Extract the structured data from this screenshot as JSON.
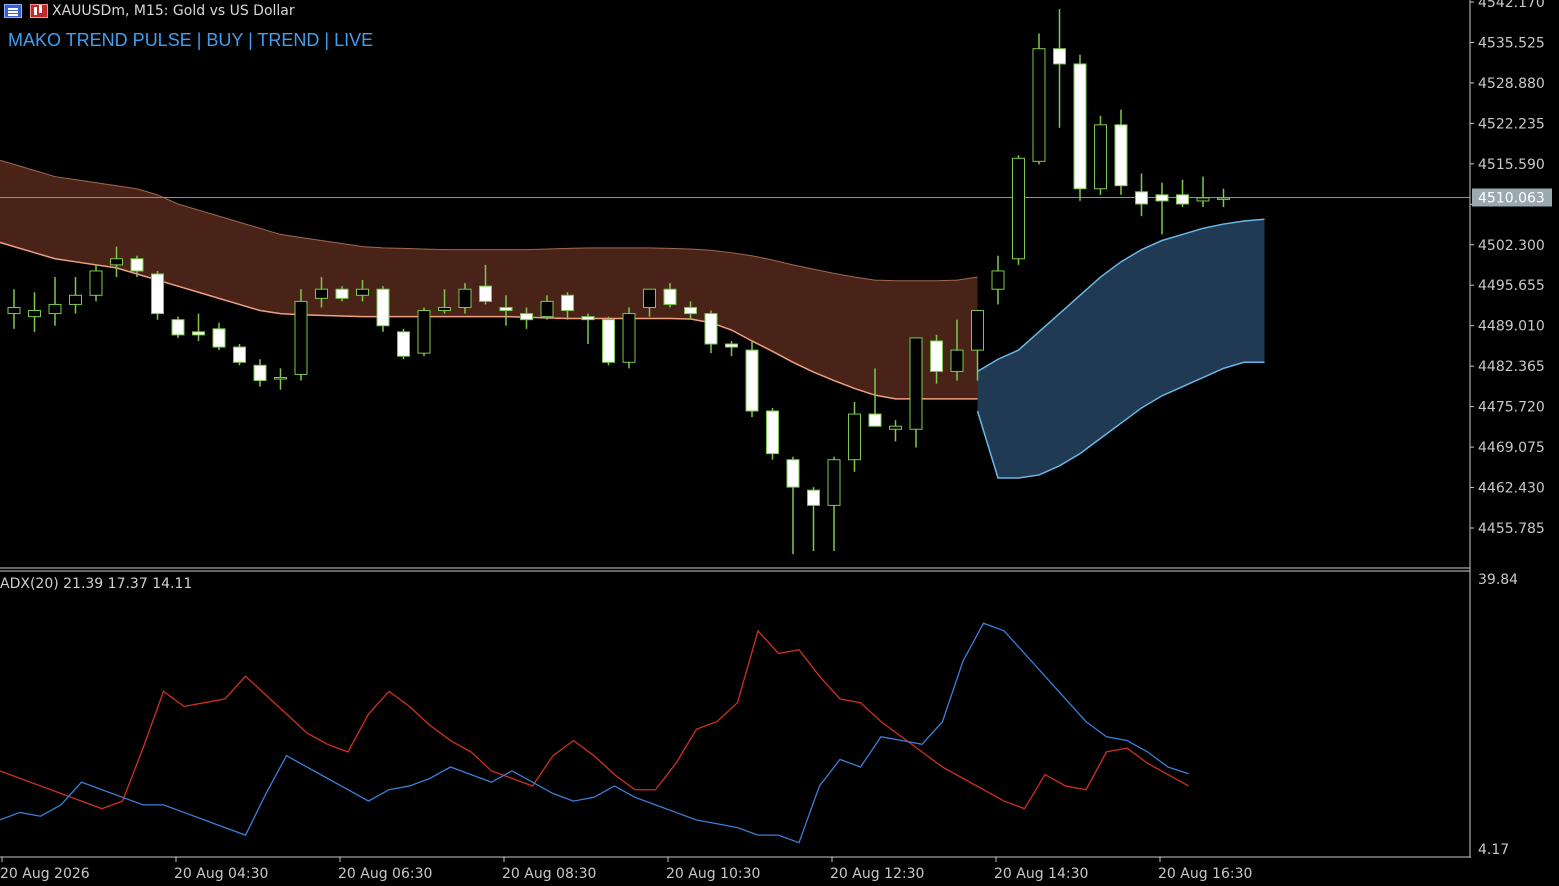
{
  "header": {
    "symbol_title": "XAUUSDm, M15:  Gold vs US Dollar",
    "signal_label": "MAKO TREND PULSE | BUY | TREND | LIVE",
    "menu_icon": "chart-menu-icon",
    "symbol_icon": "bar-chart-icon"
  },
  "indicator": {
    "label": "ADX(20) 21.39 17.37 14.11"
  },
  "colors": {
    "background": "#000000",
    "bull_candle": "#000000",
    "bear_candle": "#ffffff",
    "candle_wick": "#7ec850",
    "band_fill": "#4a2318",
    "band_edge": "#f0a080",
    "cloud_fill": "#1f3a52",
    "cloud_edge": "#6ab8e8",
    "adx_red": "#d03020",
    "adx_blue": "#3a7fd8",
    "price_tag": "#9aa8b0"
  },
  "chart_data": {
    "type": "candlestick",
    "price_axis_ticks": [
      "4542.170",
      "4535.525",
      "4528.880",
      "4522.235",
      "4515.590",
      "4510.063",
      "4502.300",
      "4495.655",
      "4489.010",
      "4482.365",
      "4475.720",
      "4469.075",
      "4462.430",
      "4455.785"
    ],
    "price_tick_values": [
      4542.17,
      4535.525,
      4528.88,
      4522.235,
      4515.59,
      4508.945,
      4502.3,
      4495.655,
      4489.01,
      4482.365,
      4475.72,
      4469.075,
      4462.43,
      4455.785
    ],
    "current_price": "4510.063",
    "current_price_value": 4510.063,
    "time_axis_labels": [
      "20 Aug 2026",
      "20 Aug 04:30",
      "20 Aug 06:30",
      "20 Aug 08:30",
      "20 Aug 10:30",
      "20 Aug 12:30",
      "20 Aug 14:30",
      "20 Aug 16:30"
    ],
    "time_label_bar_index": [
      0,
      8,
      16,
      24,
      32,
      40,
      48,
      56
    ],
    "candles": [
      {
        "o": 4491.0,
        "h": 4495.0,
        "l": 4488.5,
        "c": 4492.0
      },
      {
        "o": 4490.5,
        "h": 4494.5,
        "l": 4488.0,
        "c": 4491.5
      },
      {
        "o": 4491.0,
        "h": 4497.0,
        "l": 4489.0,
        "c": 4492.5
      },
      {
        "o": 4492.5,
        "h": 4497.0,
        "l": 4491.0,
        "c": 4494.0
      },
      {
        "o": 4494.0,
        "h": 4499.0,
        "l": 4493.0,
        "c": 4498.0
      },
      {
        "o": 4499.0,
        "h": 4502.0,
        "l": 4497.0,
        "c": 4500.0
      },
      {
        "o": 4500.0,
        "h": 4500.5,
        "l": 4497.0,
        "c": 4498.0
      },
      {
        "o": 4497.5,
        "h": 4498.0,
        "l": 4490.0,
        "c": 4491.0
      },
      {
        "o": 4490.0,
        "h": 4490.5,
        "l": 4487.0,
        "c": 4487.5
      },
      {
        "o": 4488.0,
        "h": 4491.0,
        "l": 4486.5,
        "c": 4487.5
      },
      {
        "o": 4488.5,
        "h": 4489.5,
        "l": 4485.0,
        "c": 4485.5
      },
      {
        "o": 4485.5,
        "h": 4486.0,
        "l": 4482.5,
        "c": 4483.0
      },
      {
        "o": 4482.5,
        "h": 4483.5,
        "l": 4479.0,
        "c": 4480.0
      },
      {
        "o": 4480.5,
        "h": 4482.0,
        "l": 4478.5,
        "c": 4480.5
      },
      {
        "o": 4481.0,
        "h": 4495.0,
        "l": 4480.0,
        "c": 4493.0
      },
      {
        "o": 4493.5,
        "h": 4497.0,
        "l": 4492.0,
        "c": 4495.0
      },
      {
        "o": 4495.0,
        "h": 4495.5,
        "l": 4493.0,
        "c": 4493.5
      },
      {
        "o": 4494.0,
        "h": 4496.5,
        "l": 4493.0,
        "c": 4495.0
      },
      {
        "o": 4495.0,
        "h": 4495.5,
        "l": 4488.0,
        "c": 4489.0
      },
      {
        "o": 4488.0,
        "h": 4488.5,
        "l": 4483.5,
        "c": 4484.0
      },
      {
        "o": 4484.5,
        "h": 4492.0,
        "l": 4484.0,
        "c": 4491.5
      },
      {
        "o": 4491.5,
        "h": 4495.0,
        "l": 4491.0,
        "c": 4492.0
      },
      {
        "o": 4492.0,
        "h": 4496.0,
        "l": 4491.0,
        "c": 4495.0
      },
      {
        "o": 4495.5,
        "h": 4499.0,
        "l": 4492.5,
        "c": 4493.0
      },
      {
        "o": 4492.0,
        "h": 4494.0,
        "l": 4489.0,
        "c": 4491.5
      },
      {
        "o": 4491.0,
        "h": 4492.0,
        "l": 4488.5,
        "c": 4490.0
      },
      {
        "o": 4490.5,
        "h": 4494.0,
        "l": 4490.0,
        "c": 4493.0
      },
      {
        "o": 4494.0,
        "h": 4494.5,
        "l": 4490.0,
        "c": 4491.5
      },
      {
        "o": 4490.5,
        "h": 4491.0,
        "l": 4486.0,
        "c": 4490.0
      },
      {
        "o": 4490.0,
        "h": 4490.5,
        "l": 4482.5,
        "c": 4483.0
      },
      {
        "o": 4483.0,
        "h": 4492.0,
        "l": 4482.0,
        "c": 4491.0
      },
      {
        "o": 4492.0,
        "h": 4495.0,
        "l": 4490.5,
        "c": 4495.0
      },
      {
        "o": 4495.0,
        "h": 4496.0,
        "l": 4492.0,
        "c": 4492.5
      },
      {
        "o": 4492.0,
        "h": 4493.0,
        "l": 4490.0,
        "c": 4491.0
      },
      {
        "o": 4491.0,
        "h": 4491.5,
        "l": 4484.5,
        "c": 4486.0
      },
      {
        "o": 4486.0,
        "h": 4486.5,
        "l": 4484.0,
        "c": 4485.5
      },
      {
        "o": 4485.0,
        "h": 4486.5,
        "l": 4474.0,
        "c": 4475.0
      },
      {
        "o": 4475.0,
        "h": 4475.5,
        "l": 4467.0,
        "c": 4468.0
      },
      {
        "o": 4467.0,
        "h": 4467.5,
        "l": 4451.5,
        "c": 4462.5
      },
      {
        "o": 4462.0,
        "h": 4462.5,
        "l": 4452.0,
        "c": 4459.5
      },
      {
        "o": 4459.5,
        "h": 4467.5,
        "l": 4452.0,
        "c": 4467.0
      },
      {
        "o": 4467.0,
        "h": 4476.5,
        "l": 4465.0,
        "c": 4474.5
      },
      {
        "o": 4474.5,
        "h": 4482.0,
        "l": 4472.5,
        "c": 4472.5
      },
      {
        "o": 4472.0,
        "h": 4473.5,
        "l": 4470.0,
        "c": 4472.5
      },
      {
        "o": 4472.0,
        "h": 4487.0,
        "l": 4469.0,
        "c": 4487.0
      },
      {
        "o": 4486.5,
        "h": 4487.5,
        "l": 4479.5,
        "c": 4481.5
      },
      {
        "o": 4481.5,
        "h": 4490.0,
        "l": 4480.0,
        "c": 4485.0
      },
      {
        "o": 4485.0,
        "h": 4490.5,
        "l": 4480.0,
        "c": 4491.5
      },
      {
        "o": 4495.0,
        "h": 4500.5,
        "l": 4492.5,
        "c": 4498.0
      },
      {
        "o": 4500.0,
        "h": 4517.0,
        "l": 4499.0,
        "c": 4516.5
      },
      {
        "o": 4516.0,
        "h": 4537.0,
        "l": 4515.5,
        "c": 4534.5
      },
      {
        "o": 4534.5,
        "h": 4541.0,
        "l": 4521.5,
        "c": 4532.0
      },
      {
        "o": 4532.0,
        "h": 4533.5,
        "l": 4509.5,
        "c": 4511.5
      },
      {
        "o": 4511.5,
        "h": 4523.5,
        "l": 4510.5,
        "c": 4522.0
      },
      {
        "o": 4522.0,
        "h": 4524.5,
        "l": 4510.5,
        "c": 4512.0
      },
      {
        "o": 4511.0,
        "h": 4514.0,
        "l": 4507.0,
        "c": 4509.0
      },
      {
        "o": 4510.5,
        "h": 4512.5,
        "l": 4504.0,
        "c": 4509.5
      },
      {
        "o": 4510.5,
        "h": 4513.0,
        "l": 4508.5,
        "c": 4509.0
      },
      {
        "o": 4509.5,
        "h": 4513.5,
        "l": 4508.5,
        "c": 4510.0
      },
      {
        "o": 4510.0,
        "h": 4511.5,
        "l": 4508.5,
        "c": 4510.0
      }
    ],
    "trend_band": {
      "upper": [
        4516.5,
        4515.5,
        4514.5,
        4513.5,
        4513.0,
        4512.5,
        4512.0,
        4511.5,
        4510.5,
        4509.0,
        4508.0,
        4507.0,
        4506.0,
        4505.0,
        4504.0,
        4503.5,
        4503.0,
        4502.5,
        4502.0,
        4501.8,
        4501.7,
        4501.6,
        4501.5,
        4501.5,
        4501.5,
        4501.5,
        4501.5,
        4501.6,
        4501.7,
        4501.8,
        4501.8,
        4501.8,
        4501.8,
        4501.7,
        4501.6,
        4501.4,
        4501.0,
        4500.5,
        4499.8,
        4499.0,
        4498.3,
        4497.6,
        4497.0,
        4496.5,
        4496.4,
        4496.4,
        4496.4,
        4496.5,
        4497.0
      ],
      "lower": [
        4503.0,
        4502.0,
        4501.0,
        4500.0,
        4499.5,
        4499.0,
        4498.5,
        4497.5,
        4496.5,
        4495.5,
        4494.5,
        4493.5,
        4492.5,
        4491.5,
        4491.0,
        4490.8,
        4490.7,
        4490.6,
        4490.5,
        4490.5,
        4490.5,
        4490.5,
        4490.5,
        4490.5,
        4490.5,
        4490.5,
        4490.4,
        4490.3,
        4490.2,
        4490.2,
        4490.2,
        4490.2,
        4490.2,
        4490.2,
        4490.1,
        4489.5,
        4488.3,
        4486.5,
        4484.8,
        4483.0,
        4481.4,
        4480.0,
        4478.7,
        4477.6,
        4477.0,
        4477.0,
        4477.0,
        4477.0,
        4477.0
      ]
    },
    "trend_cloud": {
      "start_index": 47,
      "upper": [
        4481.5,
        4483.5,
        4485.0,
        4488.0,
        4491.0,
        4494.0,
        4497.0,
        4499.5,
        4501.5,
        4503.0,
        4504.0,
        4505.0,
        4505.7,
        4506.2,
        4506.5
      ],
      "lower": [
        4475.0,
        4464.0,
        4464.0,
        4464.5,
        4466.0,
        4468.0,
        4470.5,
        4473.0,
        4475.5,
        4477.5,
        4479.0,
        4480.5,
        4482.0,
        4483.0,
        4483.0
      ]
    },
    "adx_axis_ticks": [
      "39.84",
      "4.17"
    ],
    "adx_axis_range": [
      4.17,
      39.84
    ],
    "adx_series": [
      {
        "values": [
          14.5,
          13.5,
          12.5,
          11.5,
          10.5,
          9.5,
          10.5,
          17.5,
          25.0,
          23.0,
          23.5,
          24.0,
          27.0,
          24.5,
          22.0,
          19.5,
          18.0,
          17.0,
          22.0,
          25.0,
          23.0,
          20.5,
          18.5,
          17.0,
          14.5,
          13.5,
          12.5,
          16.5,
          18.5,
          16.5,
          14.0,
          12.0,
          12.0,
          15.5,
          20.0,
          21.0,
          23.5,
          33.0,
          30.0,
          30.5,
          27.0,
          24.0,
          23.5,
          21.0,
          19.0,
          17.0,
          15.0,
          13.5,
          12.0,
          10.5,
          9.5,
          14.0,
          12.5,
          12.0,
          17.0,
          17.5,
          15.5,
          14.0,
          12.5
        ]
      },
      {
        "values": [
          8.0,
          9.0,
          8.5,
          10.0,
          13.0,
          12.0,
          11.0,
          10.0,
          10.0,
          9.0,
          8.0,
          7.0,
          6.0,
          11.5,
          16.5,
          15.0,
          13.5,
          12.0,
          10.5,
          12.0,
          12.5,
          13.5,
          15.0,
          14.0,
          13.0,
          14.5,
          13.0,
          11.5,
          10.5,
          11.0,
          12.5,
          11.0,
          10.0,
          9.0,
          8.0,
          7.5,
          7.0,
          6.0,
          6.0,
          5.0,
          12.5,
          16.0,
          15.0,
          19.0,
          18.5,
          18.0,
          21.0,
          29.0,
          34.0,
          33.0,
          30.0,
          27.0,
          24.0,
          21.0,
          19.0,
          18.5,
          17.0,
          15.0,
          14.11
        ]
      }
    ]
  }
}
